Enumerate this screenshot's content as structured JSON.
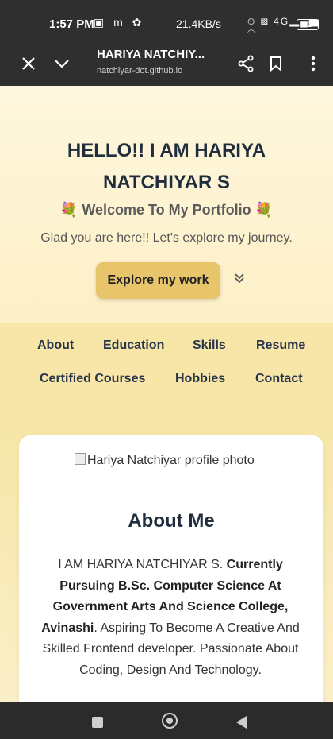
{
  "status_bar": {
    "time": "1:57 PM",
    "network_speed": "21.4KB/s",
    "signal": "4G",
    "battery": "52"
  },
  "browser": {
    "title": "HARIYA NATCHIY...",
    "url": "natchiyar-dot.github.io"
  },
  "hero": {
    "heading": "HELLO!! I AM HARIYA NATCHIYAR S",
    "welcome": "💐 Welcome To My Portfolio 💐",
    "tagline": "Glad you are here!! Let's explore my journey.",
    "cta_label": "Explore my work"
  },
  "nav": {
    "items": [
      {
        "label": "About"
      },
      {
        "label": "Education"
      },
      {
        "label": "Skills"
      },
      {
        "label": "Resume"
      },
      {
        "label": "Certified Courses"
      },
      {
        "label": "Hobbies"
      },
      {
        "label": "Contact"
      }
    ]
  },
  "about": {
    "image_alt": "Hariya Natchiyar profile photo",
    "title": "About Me",
    "bio_intro": "I AM HARIYA NATCHIYAR S. ",
    "bio_bold": "Currently Pursuing B.Sc. Computer Science At Government Arts And Science College, Avinashi",
    "bio_rest": ". Aspiring To Become A Creative And Skilled Frontend developer. Passionate About Coding, Design And Technology."
  },
  "colors": {
    "accent_button": "#e8c56a",
    "nav_background": "#f7e6a8",
    "heading_text": "#1f2d3d"
  }
}
